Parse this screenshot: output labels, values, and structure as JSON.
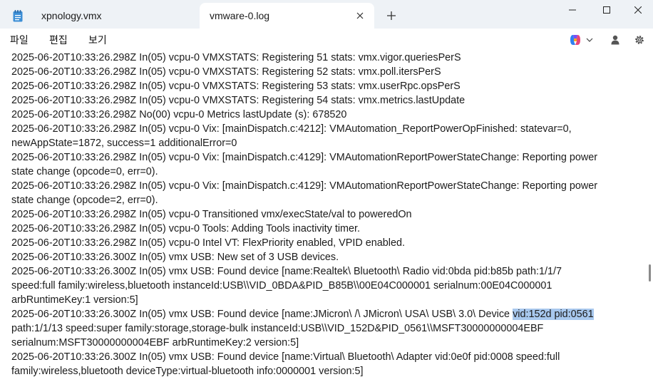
{
  "tabs": [
    {
      "label": "xpnology.vmx",
      "active": false
    },
    {
      "label": "vmware-0.log",
      "active": true
    }
  ],
  "menu": [
    "파일",
    "편집",
    "보기"
  ],
  "icons": {
    "copilot": "copilot-icon",
    "account": "account-icon",
    "settings": "gear-icon"
  },
  "colors": {
    "selection": "#a8c8ee",
    "titlebar": "#eef2f6"
  },
  "log": [
    {
      "text": "2025-06-20T10:33:26.298Z In(05) vcpu-0 VMXSTATS: Registering 51 stats: vmx.vigor.queriesPerS"
    },
    {
      "text": "2025-06-20T10:33:26.298Z In(05) vcpu-0 VMXSTATS: Registering 52 stats: vmx.poll.itersPerS"
    },
    {
      "text": "2025-06-20T10:33:26.298Z In(05) vcpu-0 VMXSTATS: Registering 53 stats: vmx.userRpc.opsPerS"
    },
    {
      "text": "2025-06-20T10:33:26.298Z In(05) vcpu-0 VMXSTATS: Registering 54 stats: vmx.metrics.lastUpdate"
    },
    {
      "text": "2025-06-20T10:33:26.298Z No(00) vcpu-0 Metrics lastUpdate (s): 678520"
    },
    {
      "text": "2025-06-20T10:33:26.298Z In(05) vcpu-0 Vix: [mainDispatch.c:4212]: VMAutomation_ReportPowerOpFinished: statevar=0,"
    },
    {
      "text": "newAppState=1872, success=1 additionalError=0"
    },
    {
      "text": "2025-06-20T10:33:26.298Z In(05) vcpu-0 Vix: [mainDispatch.c:4129]: VMAutomationReportPowerStateChange: Reporting power"
    },
    {
      "text": "state change (opcode=0, err=0)."
    },
    {
      "text": "2025-06-20T10:33:26.298Z In(05) vcpu-0 Vix: [mainDispatch.c:4129]: VMAutomationReportPowerStateChange: Reporting power"
    },
    {
      "text": "state change (opcode=2, err=0)."
    },
    {
      "text": "2025-06-20T10:33:26.298Z In(05) vcpu-0 Transitioned vmx/execState/val to poweredOn"
    },
    {
      "text": "2025-06-20T10:33:26.298Z In(05) vcpu-0 Tools: Adding Tools inactivity timer."
    },
    {
      "text": "2025-06-20T10:33:26.298Z In(05) vcpu-0 Intel VT: FlexPriority enabled, VPID enabled."
    },
    {
      "text": "2025-06-20T10:33:26.300Z In(05) vmx USB: New set of 3 USB devices."
    },
    {
      "text": "2025-06-20T10:33:26.300Z In(05) vmx USB: Found device [name:Realtek\\ Bluetooth\\ Radio vid:0bda pid:b85b path:1/1/7"
    },
    {
      "text": "speed:full family:wireless,bluetooth instanceId:USB\\\\VID_0BDA&PID_B85B\\\\00E04C000001 serialnum:00E04C000001"
    },
    {
      "text": "arbRuntimeKey:1 version:5]"
    },
    {
      "text": "2025-06-20T10:33:26.300Z In(05) vmx USB: Found device [name:JMicron\\ /\\ JMicron\\ USA\\ USB\\ 3.0\\ Device ",
      "selected": "vid:152d pid:0561"
    },
    {
      "text": "path:1/1/13 speed:super family:storage,storage-bulk instanceId:USB\\\\VID_152D&PID_0561\\\\MSFT30000000004EBF"
    },
    {
      "text": "serialnum:MSFT30000000004EBF arbRuntimeKey:2 version:5]"
    },
    {
      "text": "2025-06-20T10:33:26.300Z In(05) vmx USB: Found device [name:Virtual\\ Bluetooth\\ Adapter vid:0e0f pid:0008 speed:full"
    },
    {
      "text": "family:wireless,bluetooth deviceType:virtual-bluetooth info:0000001 version:5]"
    }
  ]
}
